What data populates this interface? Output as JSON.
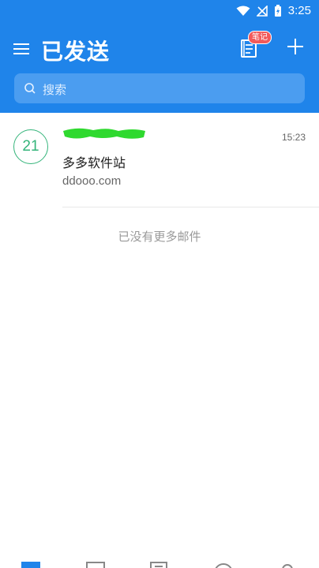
{
  "status_bar": {
    "time": "3:25",
    "icons": [
      "wifi-icon",
      "no-signal-icon",
      "battery-charging-icon"
    ]
  },
  "header": {
    "title": "已发送",
    "notes_badge": "笔记",
    "icons": [
      "menu-icon",
      "notes-icon",
      "plus-icon"
    ]
  },
  "search": {
    "placeholder": "搜索"
  },
  "mail_list": [
    {
      "avatar_text": "21",
      "sender": "",
      "subject": "多多软件站",
      "preview": "ddooo.com",
      "time": "15:23"
    }
  ],
  "list_end_text": "已没有更多邮件",
  "colors": {
    "brand_blue": "#1f84ea",
    "search_bg": "#4b9df0",
    "avatar_green": "#34b47a",
    "badge_red": "#f25a5a",
    "redaction_green": "#2fd92f"
  },
  "bottom_nav": {
    "icons": [
      "mail-tab-icon",
      "calendar-tab-icon",
      "docs-tab-icon",
      "chat-tab-icon",
      "contacts-tab-icon"
    ]
  }
}
